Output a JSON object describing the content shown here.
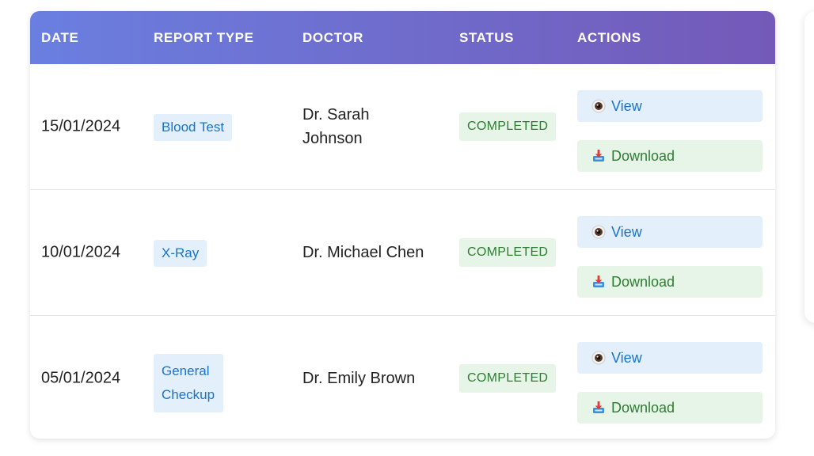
{
  "table": {
    "headers": {
      "date": "DATE",
      "report_type": "REPORT TYPE",
      "doctor": "DOCTOR",
      "status": "STATUS",
      "actions": "ACTIONS"
    },
    "rows": [
      {
        "date": "15/01/2024",
        "report_type": "Blood Test",
        "doctor": "Dr. Sarah Johnson",
        "status": "COMPLETED",
        "view_label": "View",
        "download_label": "Download"
      },
      {
        "date": "10/01/2024",
        "report_type": "X-Ray",
        "doctor": "Dr. Michael Chen",
        "status": "COMPLETED",
        "view_label": "View",
        "download_label": "Download"
      },
      {
        "date": "05/01/2024",
        "report_type": "General Checkup",
        "doctor": "Dr. Emily Brown",
        "status": "COMPLETED",
        "view_label": "View",
        "download_label": "Download"
      }
    ]
  },
  "icons": {
    "view": "eye-icon",
    "download": "download-tray-icon"
  },
  "colors": {
    "header_gradient_start": "#6a7fe0",
    "header_gradient_end": "#7459b8",
    "type_badge_text": "#1a73c9",
    "type_badge_bg": "#e3f0fb",
    "status_text": "#2e7d32",
    "status_bg": "#e7f4e8"
  }
}
